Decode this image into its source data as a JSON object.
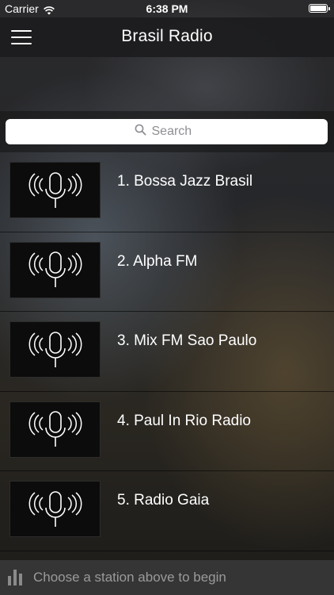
{
  "status_bar": {
    "carrier": "Carrier",
    "time": "6:38 PM",
    "icons": [
      "wifi-icon",
      "battery-icon"
    ]
  },
  "nav": {
    "title": "Brasil Radio",
    "menu_icon": "hamburger-menu-icon"
  },
  "search": {
    "placeholder": "Search",
    "icon": "search-icon"
  },
  "stations": [
    {
      "label": "1. Bossa Jazz Brasil",
      "icon": "microphone-broadcast-icon"
    },
    {
      "label": "2. Alpha FM",
      "icon": "microphone-broadcast-icon"
    },
    {
      "label": "3. Mix FM Sao Paulo",
      "icon": "microphone-broadcast-icon"
    },
    {
      "label": "4. Paul In Rio Radio",
      "icon": "microphone-broadcast-icon"
    },
    {
      "label": "5. Radio Gaia",
      "icon": "microphone-broadcast-icon"
    }
  ],
  "bottom_bar": {
    "text": "Choose a station above to begin",
    "icon": "equalizer-icon"
  },
  "colors": {
    "nav_background": "#1c1c1e",
    "text": "#ffffff",
    "muted_text": "#9a9a9a",
    "search_background": "#ffffff"
  }
}
